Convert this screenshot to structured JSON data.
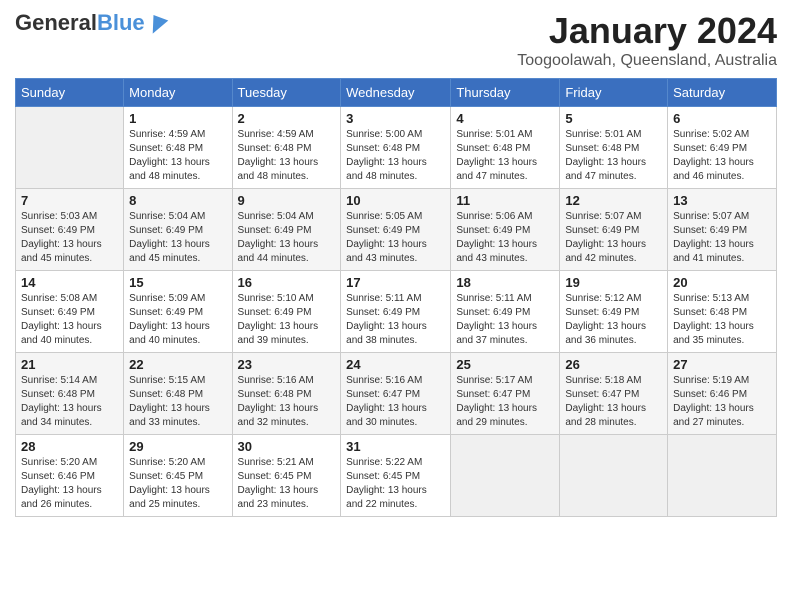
{
  "header": {
    "logo": {
      "general": "General",
      "blue": "Blue"
    },
    "title": "January 2024",
    "subtitle": "Toogoolawah, Queensland, Australia"
  },
  "days_of_week": [
    "Sunday",
    "Monday",
    "Tuesday",
    "Wednesday",
    "Thursday",
    "Friday",
    "Saturday"
  ],
  "weeks": [
    [
      {
        "day": "",
        "empty": true
      },
      {
        "day": "1",
        "sunrise": "4:59 AM",
        "sunset": "6:48 PM",
        "daylight": "13 hours and 48 minutes."
      },
      {
        "day": "2",
        "sunrise": "4:59 AM",
        "sunset": "6:48 PM",
        "daylight": "13 hours and 48 minutes."
      },
      {
        "day": "3",
        "sunrise": "5:00 AM",
        "sunset": "6:48 PM",
        "daylight": "13 hours and 48 minutes."
      },
      {
        "day": "4",
        "sunrise": "5:01 AM",
        "sunset": "6:48 PM",
        "daylight": "13 hours and 47 minutes."
      },
      {
        "day": "5",
        "sunrise": "5:01 AM",
        "sunset": "6:48 PM",
        "daylight": "13 hours and 47 minutes."
      },
      {
        "day": "6",
        "sunrise": "5:02 AM",
        "sunset": "6:49 PM",
        "daylight": "13 hours and 46 minutes."
      }
    ],
    [
      {
        "day": "7",
        "sunrise": "5:03 AM",
        "sunset": "6:49 PM",
        "daylight": "13 hours and 45 minutes."
      },
      {
        "day": "8",
        "sunrise": "5:04 AM",
        "sunset": "6:49 PM",
        "daylight": "13 hours and 45 minutes."
      },
      {
        "day": "9",
        "sunrise": "5:04 AM",
        "sunset": "6:49 PM",
        "daylight": "13 hours and 44 minutes."
      },
      {
        "day": "10",
        "sunrise": "5:05 AM",
        "sunset": "6:49 PM",
        "daylight": "13 hours and 43 minutes."
      },
      {
        "day": "11",
        "sunrise": "5:06 AM",
        "sunset": "6:49 PM",
        "daylight": "13 hours and 43 minutes."
      },
      {
        "day": "12",
        "sunrise": "5:07 AM",
        "sunset": "6:49 PM",
        "daylight": "13 hours and 42 minutes."
      },
      {
        "day": "13",
        "sunrise": "5:07 AM",
        "sunset": "6:49 PM",
        "daylight": "13 hours and 41 minutes."
      }
    ],
    [
      {
        "day": "14",
        "sunrise": "5:08 AM",
        "sunset": "6:49 PM",
        "daylight": "13 hours and 40 minutes."
      },
      {
        "day": "15",
        "sunrise": "5:09 AM",
        "sunset": "6:49 PM",
        "daylight": "13 hours and 40 minutes."
      },
      {
        "day": "16",
        "sunrise": "5:10 AM",
        "sunset": "6:49 PM",
        "daylight": "13 hours and 39 minutes."
      },
      {
        "day": "17",
        "sunrise": "5:11 AM",
        "sunset": "6:49 PM",
        "daylight": "13 hours and 38 minutes."
      },
      {
        "day": "18",
        "sunrise": "5:11 AM",
        "sunset": "6:49 PM",
        "daylight": "13 hours and 37 minutes."
      },
      {
        "day": "19",
        "sunrise": "5:12 AM",
        "sunset": "6:49 PM",
        "daylight": "13 hours and 36 minutes."
      },
      {
        "day": "20",
        "sunrise": "5:13 AM",
        "sunset": "6:48 PM",
        "daylight": "13 hours and 35 minutes."
      }
    ],
    [
      {
        "day": "21",
        "sunrise": "5:14 AM",
        "sunset": "6:48 PM",
        "daylight": "13 hours and 34 minutes."
      },
      {
        "day": "22",
        "sunrise": "5:15 AM",
        "sunset": "6:48 PM",
        "daylight": "13 hours and 33 minutes."
      },
      {
        "day": "23",
        "sunrise": "5:16 AM",
        "sunset": "6:48 PM",
        "daylight": "13 hours and 32 minutes."
      },
      {
        "day": "24",
        "sunrise": "5:16 AM",
        "sunset": "6:47 PM",
        "daylight": "13 hours and 30 minutes."
      },
      {
        "day": "25",
        "sunrise": "5:17 AM",
        "sunset": "6:47 PM",
        "daylight": "13 hours and 29 minutes."
      },
      {
        "day": "26",
        "sunrise": "5:18 AM",
        "sunset": "6:47 PM",
        "daylight": "13 hours and 28 minutes."
      },
      {
        "day": "27",
        "sunrise": "5:19 AM",
        "sunset": "6:46 PM",
        "daylight": "13 hours and 27 minutes."
      }
    ],
    [
      {
        "day": "28",
        "sunrise": "5:20 AM",
        "sunset": "6:46 PM",
        "daylight": "13 hours and 26 minutes."
      },
      {
        "day": "29",
        "sunrise": "5:20 AM",
        "sunset": "6:45 PM",
        "daylight": "13 hours and 25 minutes."
      },
      {
        "day": "30",
        "sunrise": "5:21 AM",
        "sunset": "6:45 PM",
        "daylight": "13 hours and 23 minutes."
      },
      {
        "day": "31",
        "sunrise": "5:22 AM",
        "sunset": "6:45 PM",
        "daylight": "13 hours and 22 minutes."
      },
      {
        "day": "",
        "empty": true
      },
      {
        "day": "",
        "empty": true
      },
      {
        "day": "",
        "empty": true
      }
    ]
  ]
}
